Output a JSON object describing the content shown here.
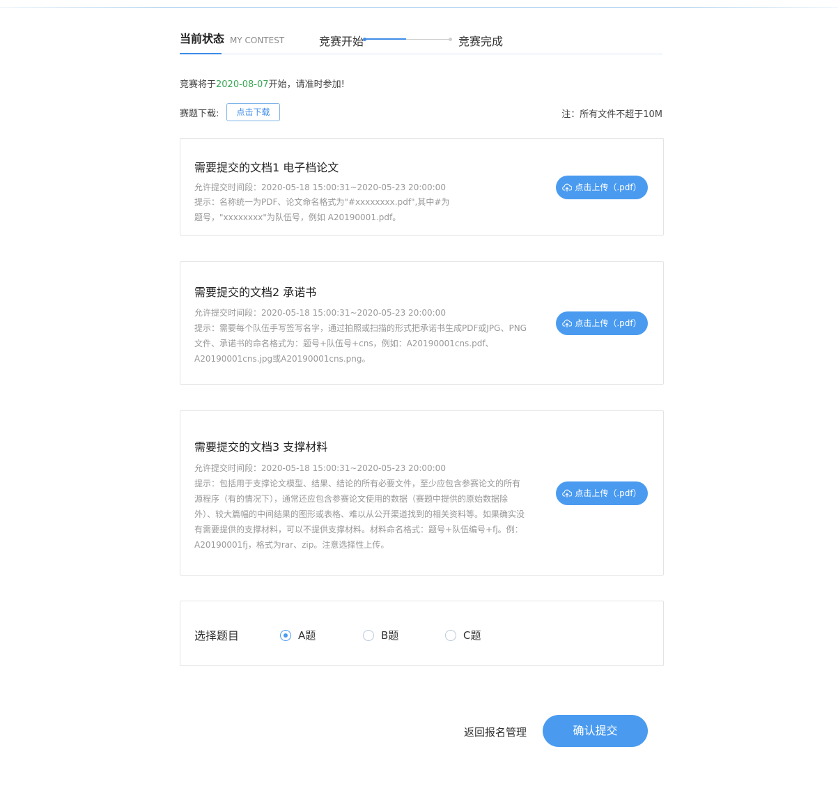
{
  "header": {
    "current_status": "当前状态",
    "current_status_sub": "MY CONTEST",
    "step_start": "竞赛开始",
    "step_done": "竞赛完成"
  },
  "notice": {
    "prefix": "竞赛将于",
    "date": "2020-08-07",
    "suffix": "开始，请准时参加!"
  },
  "download": {
    "label": "赛题下载:",
    "button": "点击下载",
    "note": "注：所有文件不超于10M"
  },
  "documents": [
    {
      "title": "需要提交的文档1 电子档论文",
      "period": "允许提交时间段：2020-05-18 15:00:31~2020-05-23 20:00:00",
      "hint": "提示：名称统一为PDF、论文命名格式为\"#xxxxxxxx.pdf\",其中#为题号，\"xxxxxxxx\"为队伍号，例如 A20190001.pdf。",
      "upload_label": "点击上传（.pdf）"
    },
    {
      "title": "需要提交的文档2 承诺书",
      "period": "允许提交时间段：2020-05-18 15:00:31~2020-05-23 20:00:00",
      "hint": "提示：需要每个队伍手写签写名字，通过拍照或扫描的形式把承诺书生成PDF或JPG、PNG文件、承诺书的命名格式为：题号+队伍号+cns，例如：A20190001cns.pdf、A20190001cns.jpg或A20190001cns.png。",
      "upload_label": "点击上传（.pdf）"
    },
    {
      "title": "需要提交的文档3 支撑材料",
      "period": "允许提交时间段：2020-05-18 15:00:31~2020-05-23 20:00:00",
      "hint": "提示：包括用于支撑论文模型、结果、结论的所有必要文件，至少应包含参赛论文的所有源程序（有的情况下），通常还应包含参赛论文使用的数据（赛题中提供的原始数据除外）、较大篇幅的中间结果的图形或表格、难以从公开渠道找到的相关资料等。如果确实没有需要提供的支撑材料，可以不提供支撑材料。材料命名格式：题号+队伍编号+fj。例：A20190001fj，格式为rar、zip。注意选择性上传。",
      "upload_label": "点击上传（.pdf）"
    }
  ],
  "topic": {
    "label": "选择题目",
    "options": [
      {
        "label": "A题",
        "checked": true
      },
      {
        "label": "B题",
        "checked": false
      },
      {
        "label": "C题",
        "checked": false
      }
    ]
  },
  "actions": {
    "back": "返回报名管理",
    "confirm": "确认提交"
  },
  "colors": {
    "accent": "#4a9bf0",
    "date_green": "#3aa655"
  }
}
